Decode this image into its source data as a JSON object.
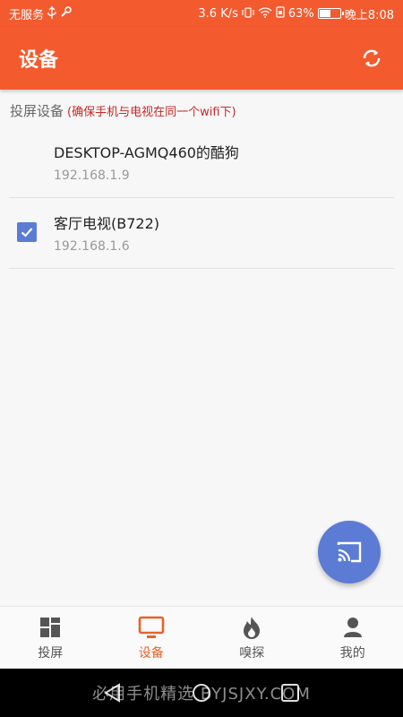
{
  "status_bar": {
    "carrier": "无服务",
    "speed": "3.6 K/s",
    "battery": "63%",
    "battery_level": 0.63,
    "time": "晚上8:08"
  },
  "app_bar": {
    "title": "设备",
    "refresh_icon": "refresh-icon"
  },
  "hint": {
    "label": "投屏设备",
    "warning": "(确保手机与电视在同一个wifi下)"
  },
  "devices": [
    {
      "name": "DESKTOP-AGMQ460的酷狗",
      "ip": "192.168.1.9",
      "checked": false
    },
    {
      "name": "客厅电视(B722)",
      "ip": "192.168.1.6",
      "checked": true
    }
  ],
  "fab": {
    "icon": "cast-icon"
  },
  "bottom_nav": {
    "items": [
      {
        "label": "投屏",
        "icon": "grid-icon"
      },
      {
        "label": "设备",
        "icon": "tv-icon",
        "active": true
      },
      {
        "label": "嗅探",
        "icon": "flame-icon"
      },
      {
        "label": "我的",
        "icon": "person-icon"
      }
    ]
  },
  "watermark": "必用手机精选 BYJSJXY.COM",
  "colors": {
    "primary": "#f35b2f",
    "accent": "#5b7bd5",
    "active_nav": "#e8622a"
  }
}
